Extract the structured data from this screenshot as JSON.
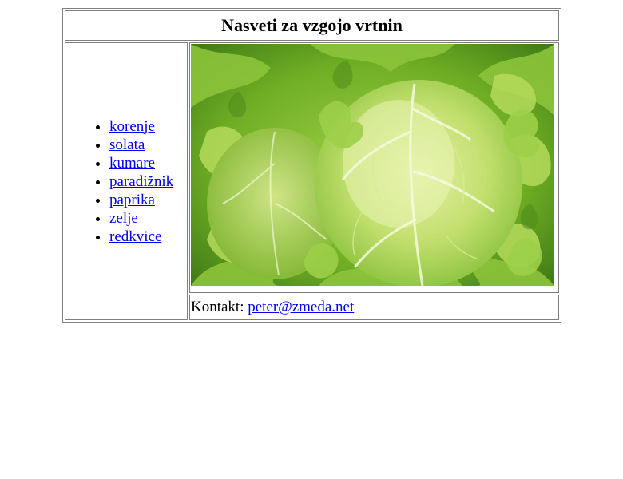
{
  "header": {
    "title": "Nasveti za vzgojo vrtnin"
  },
  "nav": {
    "items": [
      {
        "label": "korenje"
      },
      {
        "label": "solata"
      },
      {
        "label": "kumare"
      },
      {
        "label": "paradižnik"
      },
      {
        "label": "paprika"
      },
      {
        "label": "zelje"
      },
      {
        "label": "redkvice"
      }
    ]
  },
  "main": {
    "image_subject": "lettuce-photo"
  },
  "footer": {
    "contact_label": "Kontakt:",
    "email": "peter@zmeda.net"
  },
  "colors": {
    "link": "#0000ee",
    "border": "#808080",
    "lettuce_light": "#c9e27a",
    "lettuce_dark": "#3f7a16"
  }
}
